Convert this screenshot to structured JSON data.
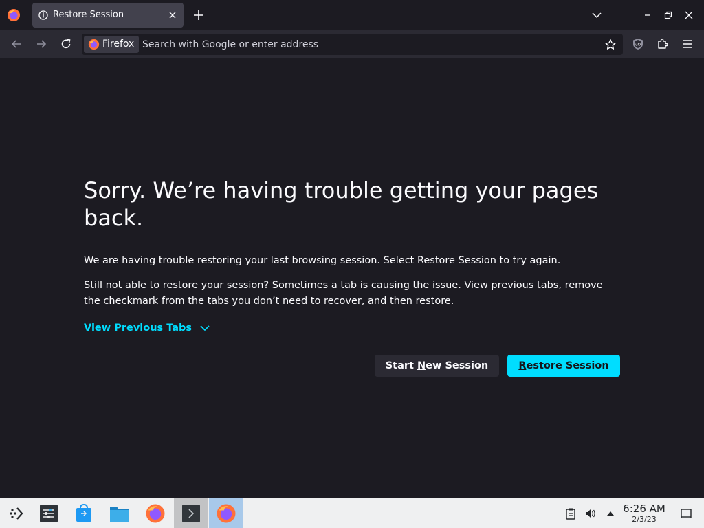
{
  "tab": {
    "title": "Restore Session"
  },
  "urlbar": {
    "identity_label": "Firefox",
    "placeholder": "Search with Google or enter address"
  },
  "page": {
    "title": "Sorry. We’re having trouble getting your pages back.",
    "para1": "We are having trouble restoring your last browsing session. Select Restore Session to try again.",
    "para2": "Still not able to restore your session? Sometimes a tab is causing the issue. View previous tabs, remove the checkmark from the tabs you don’t need to recover, and then restore.",
    "view_previous_tabs": "View Previous Tabs",
    "start_new_session": {
      "pre": "Start ",
      "accel": "N",
      "post": "ew Session"
    },
    "restore_session": {
      "pre": "",
      "accel": "R",
      "post": "estore Session"
    }
  },
  "taskbar": {
    "time": "6:26 AM",
    "date": "2/3/23",
    "apps": [
      "app-launcher-icon",
      "system-settings-icon",
      "discover-store-icon",
      "file-manager-icon",
      "firefox-icon",
      "terminal-icon",
      "firefox-icon"
    ]
  },
  "colors": {
    "accent": "#00ddff",
    "background": "#1c1b22",
    "toolbar": "#2b2a33",
    "tab_selected": "#42414d",
    "taskbar": "#eff0f1"
  }
}
